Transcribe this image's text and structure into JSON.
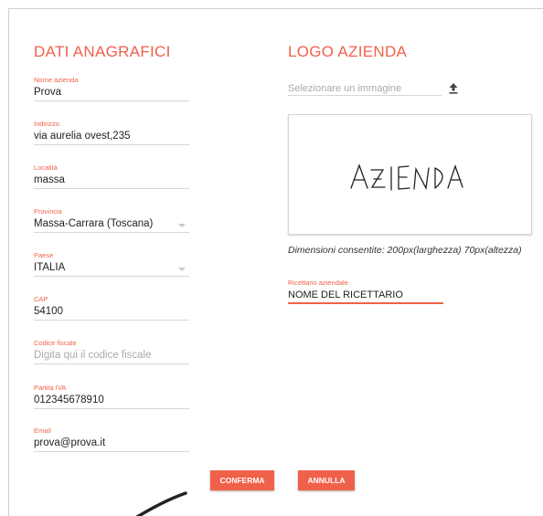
{
  "colors": {
    "accent": "#f0614a",
    "text": "#222222",
    "muted": "#aaaaaa",
    "line": "#d6d6d6"
  },
  "left_section": {
    "title": "DATI ANAGRAFICI",
    "fields": [
      {
        "label": "Nome azienda",
        "value": "Prova"
      },
      {
        "label": "Indirizzo",
        "value": "via aurelia ovest,235"
      },
      {
        "label": "Località",
        "value": "massa"
      },
      {
        "label": "Provincia",
        "value": "Massa-Carrara (Toscana)",
        "dropdown": true
      },
      {
        "label": "Paese",
        "value": "ITALIA",
        "dropdown": true
      },
      {
        "label": "CAP",
        "value": "54100"
      },
      {
        "label": "Codice fiscale",
        "placeholder": "Digita qui il codice fiscale"
      },
      {
        "label": "Partita IVA",
        "value": "012345678910"
      },
      {
        "label": "Email",
        "value": "prova@prova.it"
      }
    ]
  },
  "right_section": {
    "title": "LOGO AZIENDA",
    "upload_placeholder": "Selezionare un immagine",
    "upload_icon": "upload-icon",
    "logo_text": "AZIENDA",
    "dimensions_text": "Dimensioni consentite: 200px(larghezza) 70px(altezza)",
    "ricettario": {
      "label": "Ricettario aziendale",
      "value": "NOME DEL RICETTARIO"
    }
  },
  "actions": {
    "confirm_label": "CONFERMA",
    "cancel_label": "ANNULLA"
  }
}
